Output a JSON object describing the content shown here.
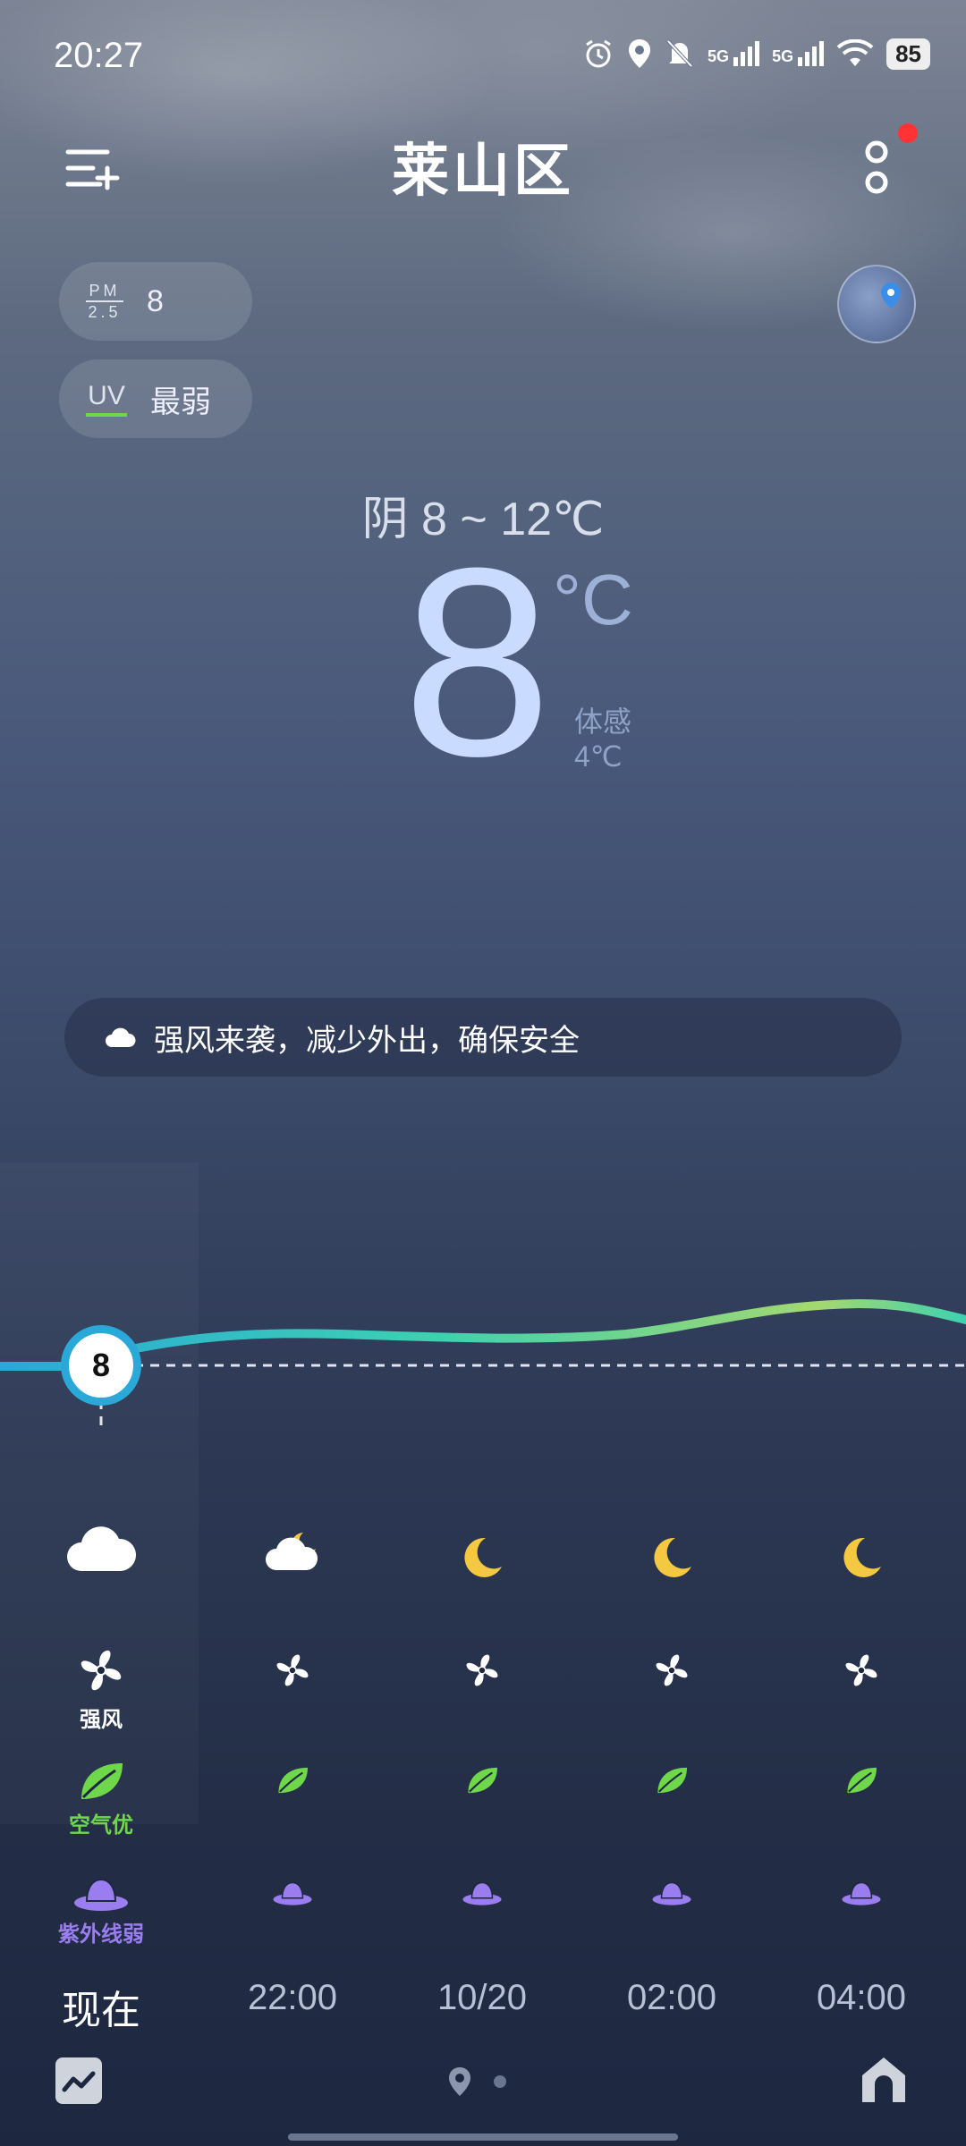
{
  "status": {
    "time": "20:27",
    "signal_1": "5G",
    "signal_2": "5G",
    "battery": "85"
  },
  "header": {
    "city": "莱山区"
  },
  "air": {
    "pm_label_top": "PM",
    "pm_label_bottom": "2.5",
    "pm_value": "8",
    "uv_label": "UV",
    "uv_value": "最弱"
  },
  "current": {
    "summary": "阴  8 ~ 12℃",
    "temp": "8",
    "unit": "°C",
    "feels_label": "体感",
    "feels_value": "4℃"
  },
  "alert": {
    "text": "强风来袭，减少外出，确保安全"
  },
  "forecast": {
    "now_temp": "8",
    "labels": {
      "wind": "强风",
      "air": "空气优",
      "uv": "紫外线弱"
    },
    "times": [
      "现在",
      "22:00",
      "10/20",
      "02:00",
      "04:00"
    ],
    "weather_icons": [
      "cloud-icon",
      "cloudy-moon-icon",
      "moon-icon",
      "moon-icon",
      "moon-icon"
    ]
  },
  "colors": {
    "curve_start": "#2aa8d8",
    "curve_mid": "#3dd1b0",
    "curve_end": "#a4d870",
    "air_green": "#6fd84a",
    "uv_purple": "#9a7ef0",
    "notify": "#ff3333"
  }
}
